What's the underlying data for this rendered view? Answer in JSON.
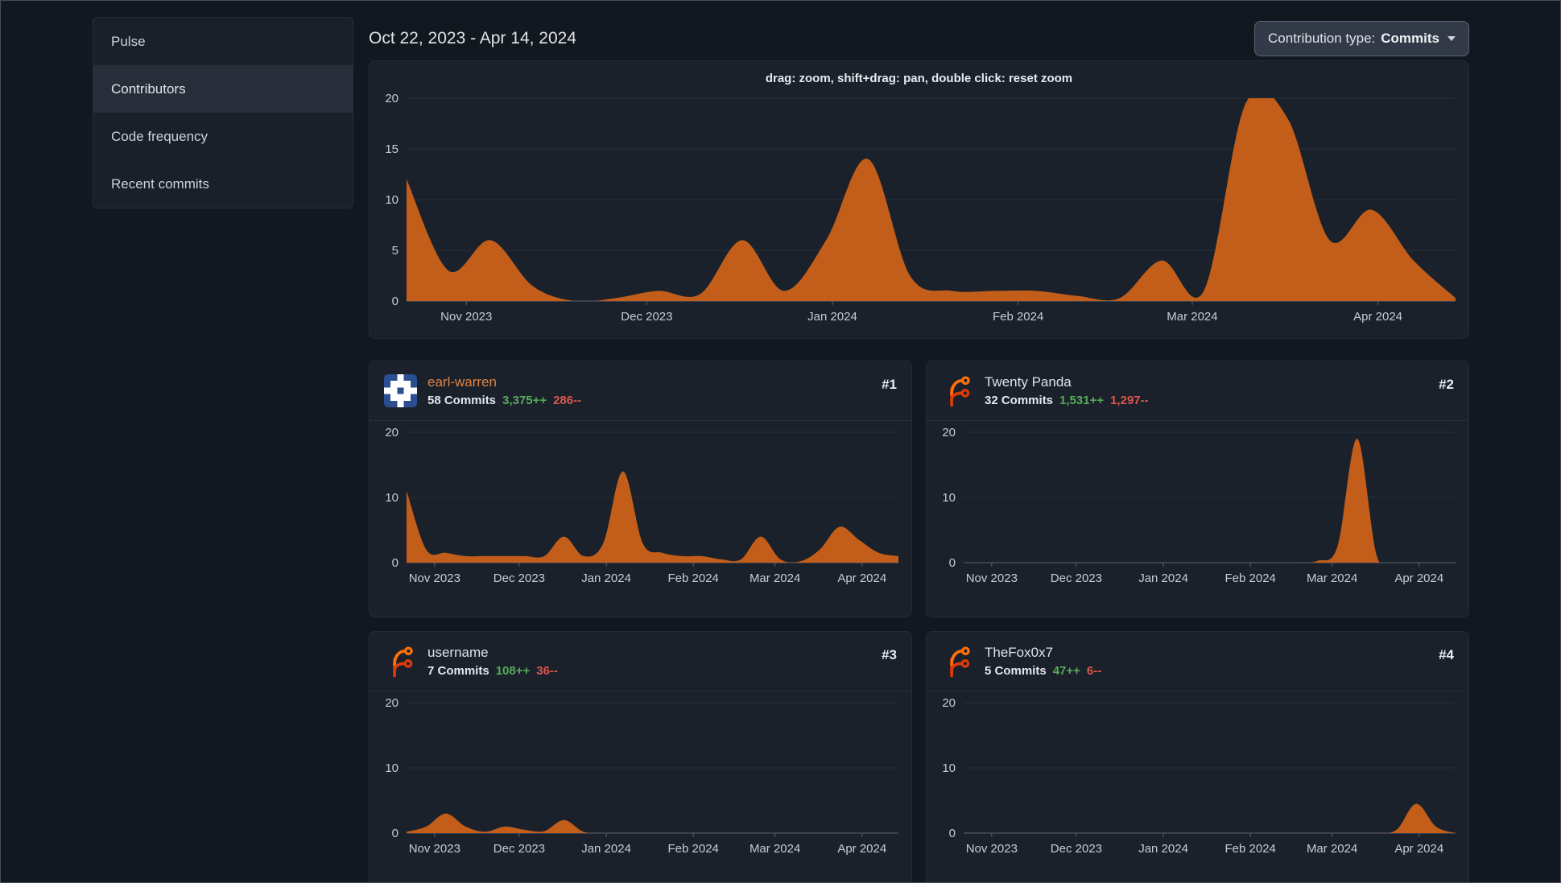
{
  "page": {
    "date_range": "Oct 22, 2023 - Apr 14, 2024",
    "contribution_type_label": "Contribution type:",
    "contribution_type_value": "Commits",
    "chart_hint": "drag: zoom, shift+drag: pan, double click: reset zoom"
  },
  "sidebar": {
    "items": [
      {
        "label": "Pulse",
        "active": false
      },
      {
        "label": "Contributors",
        "active": true
      },
      {
        "label": "Code frequency",
        "active": false
      },
      {
        "label": "Recent commits",
        "active": false
      }
    ]
  },
  "colors": {
    "area": "#c25e1a",
    "grid": "#2a303a",
    "axis_line": "#5a6270",
    "tick_text": "#c6ccd4",
    "green": "#57ab5a",
    "red": "#da574f",
    "link_orange": "#dd8345",
    "name_default": "#dde2e8"
  },
  "axis": {
    "y_max": 20,
    "main_y_ticks": [
      0,
      5,
      10,
      15,
      20
    ],
    "card_y_ticks": [
      0,
      10,
      20
    ],
    "x_fracs": [
      0.057,
      0.229,
      0.406,
      0.583,
      0.749,
      0.926
    ],
    "x_labels": [
      "Nov 2023",
      "Dec 2023",
      "Jan 2024",
      "Feb 2024",
      "Mar 2024",
      "Apr 2024"
    ]
  },
  "main_chart": {
    "type": "area",
    "values": [
      12,
      3,
      6,
      1.5,
      0,
      0.3,
      1,
      0.7,
      6,
      1,
      6,
      14,
      2.5,
      1,
      1,
      1,
      0.5,
      0.3,
      4,
      1,
      19.5,
      18,
      6,
      9,
      4,
      0.3
    ]
  },
  "contributors": [
    {
      "name": "earl-warren",
      "name_color": "#dd8345",
      "rank": "#1",
      "commits": "58 Commits",
      "additions": "3,375++",
      "deletions": "286--",
      "chart_values": [
        11,
        2,
        1.5,
        1,
        1,
        1,
        1,
        1,
        4,
        1,
        3,
        14,
        3,
        1.5,
        1,
        1,
        0.5,
        0.5,
        4,
        0.5,
        0.2,
        2,
        5.5,
        3.5,
        1.5,
        1
      ]
    },
    {
      "name": "Twenty Panda",
      "name_color": "#dde2e8",
      "rank": "#2",
      "commits": "32 Commits",
      "additions": "1,531++",
      "deletions": "1,297--",
      "chart_values": [
        0,
        0,
        0,
        0,
        0,
        0,
        0,
        0,
        0,
        0,
        0,
        0,
        0,
        0,
        0,
        0,
        0,
        0,
        0.3,
        2.5,
        19,
        1,
        0,
        0,
        0,
        0
      ]
    },
    {
      "name": "username",
      "name_color": "#dde2e8",
      "rank": "#3",
      "commits": "7 Commits",
      "additions": "108++",
      "deletions": "36--",
      "chart_values": [
        0.2,
        1,
        3,
        1,
        0.2,
        1,
        0.5,
        0.3,
        2,
        0.2,
        0,
        0,
        0,
        0,
        0,
        0,
        0,
        0,
        0,
        0,
        0,
        0,
        0,
        0,
        0,
        0
      ]
    },
    {
      "name": "TheFox0x7",
      "name_color": "#dde2e8",
      "rank": "#4",
      "commits": "5 Commits",
      "additions": "47++",
      "deletions": "6--",
      "chart_values": [
        0,
        0,
        0,
        0,
        0,
        0,
        0,
        0,
        0,
        0,
        0,
        0,
        0,
        0,
        0,
        0,
        0,
        0,
        0,
        0,
        0,
        0,
        0.5,
        4.5,
        1,
        0
      ]
    }
  ]
}
